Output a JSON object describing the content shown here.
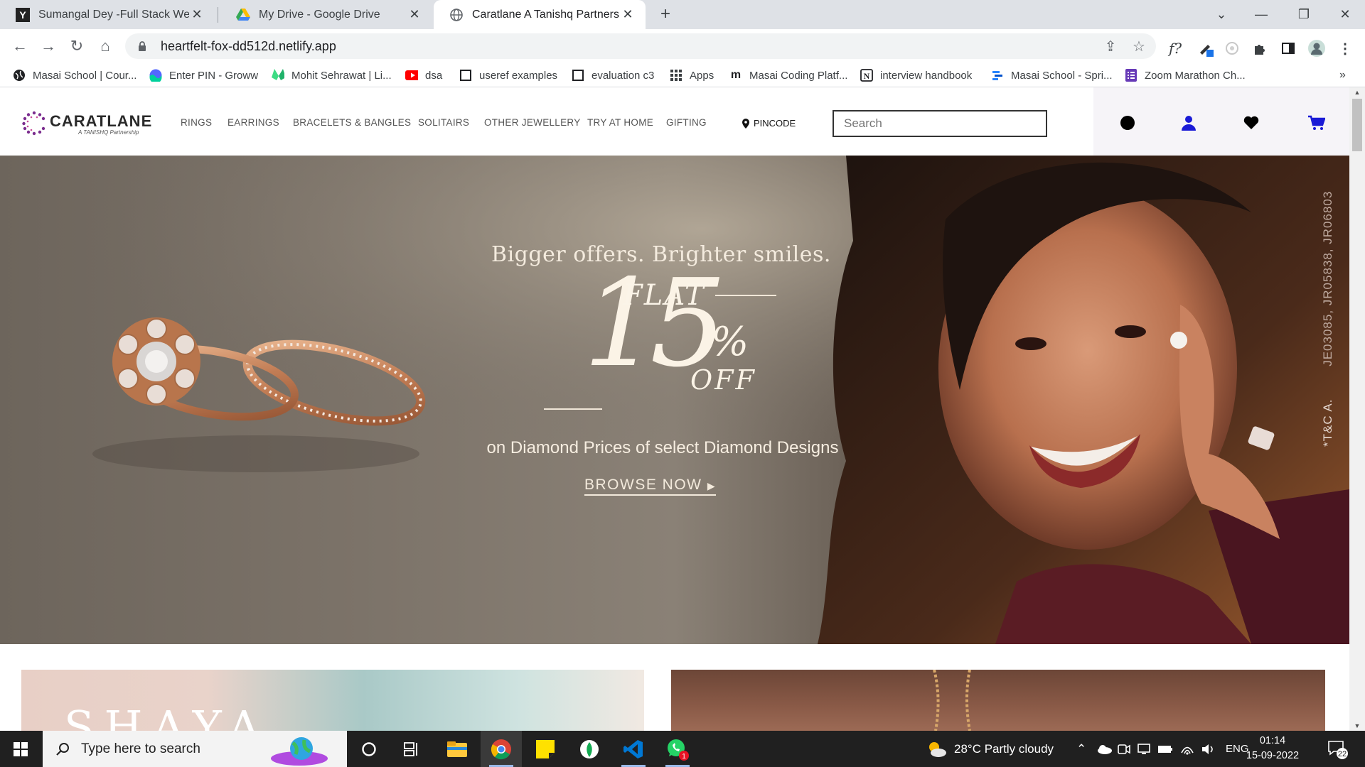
{
  "browser": {
    "tabs": [
      {
        "title": "Sumangal Dey -Full Stack Web D",
        "icon": "y-icon"
      },
      {
        "title": "My Drive - Google Drive",
        "icon": "google-drive-icon"
      },
      {
        "title": "Caratlane A Tanishq Partnership",
        "icon": "globe-icon"
      }
    ],
    "url": "heartfelt-fox-dd512d.netlify.app"
  },
  "bookmarks": [
    {
      "label": "Masai School | Cour...",
      "icon": "globe-icon"
    },
    {
      "label": "Enter PIN - Groww",
      "icon": "groww-icon"
    },
    {
      "label": "Mohit Sehrawat | Li...",
      "icon": "green-logo-icon"
    },
    {
      "label": "dsa",
      "icon": "youtube-icon"
    },
    {
      "label": "useref examples",
      "icon": "checkbox-icon"
    },
    {
      "label": "evaluation c3",
      "icon": "checkbox-icon"
    },
    {
      "label": "Apps",
      "icon": "apps-grid-icon"
    },
    {
      "label": "Masai Coding Platf...",
      "icon": "m-icon"
    },
    {
      "label": "interview handbook",
      "icon": "notion-icon"
    },
    {
      "label": "Masai School - Spri...",
      "icon": "jira-icon"
    },
    {
      "label": "Zoom Marathon Ch...",
      "icon": "form-icon"
    }
  ],
  "site": {
    "logo": {
      "brand": "CARATLANE",
      "tagline": "A TANISHQ Partnership"
    },
    "nav": [
      "RINGS",
      "EARRINGS",
      "BRACELETS & BANGLES",
      "SOLITAIRS",
      "OTHER JEWELLERY",
      "TRY AT HOME",
      "GIFTING"
    ],
    "pincode": "PINCODE",
    "search_placeholder": "Search"
  },
  "hero": {
    "headline": "Bigger offers. Brighter smiles.",
    "flat": "FLAT",
    "number": "15",
    "percent": "%",
    "off": "OFF",
    "description": "on Diamond Prices of select Diamond Designs",
    "cta": "BROWSE NOW",
    "side_code": "JE03085, JR05838, JR06803",
    "side_tag": "*T&C A."
  },
  "cards": {
    "first_title": "SHAYA"
  },
  "taskbar": {
    "search_placeholder": "Type here to search",
    "weather": "28°C  Partly cloudy",
    "language": "ENG",
    "time": "01:14",
    "date": "15-09-2022",
    "notifications": "22",
    "whatsapp_badge": "1"
  },
  "colors": {
    "accent": "#1a1ad6",
    "brand_purple": "#7b2d8e",
    "hero_text": "#f5ece0"
  }
}
